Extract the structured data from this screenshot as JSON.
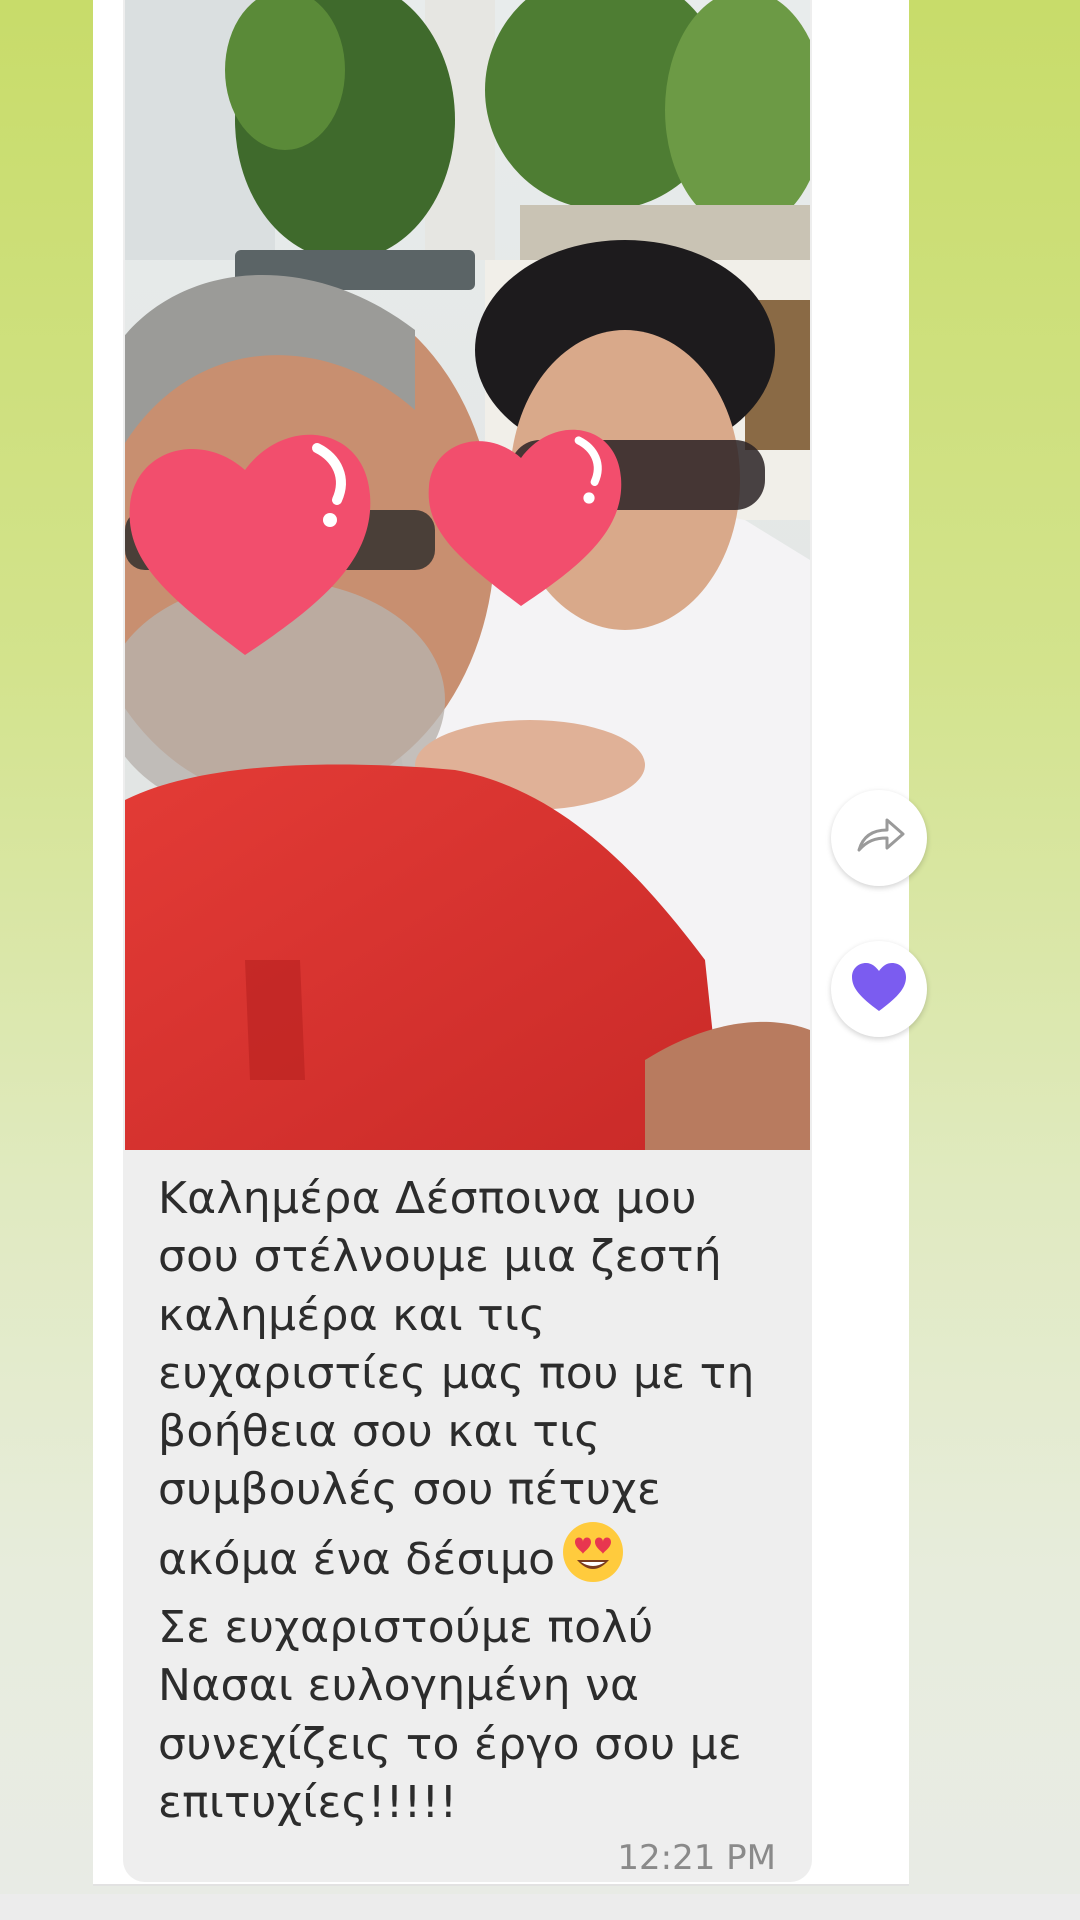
{
  "message": {
    "text": "Καλημέρα Δέσποινα μου\nσου στέλνουμε μια ζεστή\nκαλημέρα και τις\nευχαριστίες μας που με τη\nβοήθεια σου και τις\nσυμβουλές σου πέτυχε\nακόμα ένα δέσιμο",
    "text_after_emoji": "\nΣε ευχαριστούμε πολύ\nΝασαι ευλογημένη να\nσυνεχίζεις το έργο σου με\nεπιτυχίες!!!!!",
    "emoji": "heart-eyes-emoji",
    "time": "12:21 PM",
    "attachment": "photo"
  },
  "actions": {
    "share_icon": "share-arrow-icon",
    "like_icon": "heart-icon",
    "like_color": "#7b5cf0"
  },
  "colors": {
    "bubble_bg": "#eeeeee",
    "text": "#2c2c2c",
    "timestamp": "#8a8a8a"
  }
}
